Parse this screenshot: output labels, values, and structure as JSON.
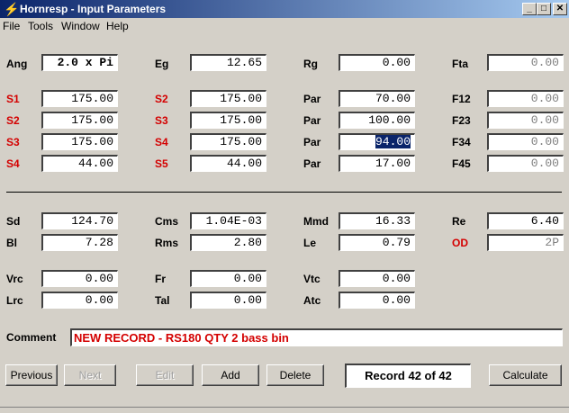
{
  "window": {
    "title": "Hornresp - Input Parameters",
    "minimize": "_",
    "maximize": "□",
    "close": "✕"
  },
  "menu": [
    "File",
    "Tools",
    "Window",
    "Help"
  ],
  "colors": {
    "titlebar": "#0a246a",
    "red_label": "#d40000"
  },
  "row1": {
    "ang": {
      "label": "Ang",
      "value": "2.0 x Pi"
    },
    "eg": {
      "label": "Eg",
      "value": "12.65"
    },
    "rg": {
      "label": "Rg",
      "value": "0.00"
    },
    "fta": {
      "label": "Fta",
      "value": "0.00"
    }
  },
  "segments": [
    {
      "s_a": "S1",
      "v_a": "175.00",
      "s_b": "S2",
      "v_b": "175.00",
      "par": "Par",
      "v_par": "70.00",
      "f": "F12",
      "v_f": "0.00"
    },
    {
      "s_a": "S2",
      "v_a": "175.00",
      "s_b": "S3",
      "v_b": "175.00",
      "par": "Par",
      "v_par": "100.00",
      "f": "F23",
      "v_f": "0.00"
    },
    {
      "s_a": "S3",
      "v_a": "175.00",
      "s_b": "S4",
      "v_b": "175.00",
      "par": "Par",
      "v_par": "94.00",
      "f": "F34",
      "v_f": "0.00"
    },
    {
      "s_a": "S4",
      "v_a": "44.00",
      "s_b": "S5",
      "v_b": "44.00",
      "par": "Par",
      "v_par": "17.00",
      "f": "F45",
      "v_f": "0.00"
    }
  ],
  "driver": {
    "sd": {
      "label": "Sd",
      "value": "124.70"
    },
    "cms": {
      "label": "Cms",
      "value": "1.04E-03"
    },
    "mmd": {
      "label": "Mmd",
      "value": "16.33"
    },
    "re": {
      "label": "Re",
      "value": "6.40"
    },
    "bl": {
      "label": "Bl",
      "value": "7.28"
    },
    "rms": {
      "label": "Rms",
      "value": "2.80"
    },
    "le": {
      "label": "Le",
      "value": "0.79"
    },
    "od": {
      "label": "OD",
      "value": "2P"
    }
  },
  "chamber": {
    "vrc": {
      "label": "Vrc",
      "value": "0.00"
    },
    "fr": {
      "label": "Fr",
      "value": "0.00"
    },
    "vtc": {
      "label": "Vtc",
      "value": "0.00"
    },
    "lrc": {
      "label": "Lrc",
      "value": "0.00"
    },
    "tal": {
      "label": "Tal",
      "value": "0.00"
    },
    "atc": {
      "label": "Atc",
      "value": "0.00"
    }
  },
  "comment": {
    "label": "Comment",
    "value": "NEW RECORD - RS180 QTY 2 bass bin"
  },
  "buttons": {
    "previous": "Previous",
    "next": "Next",
    "edit": "Edit",
    "add": "Add",
    "delete": "Delete",
    "calculate": "Calculate"
  },
  "record": "Record 42 of 42"
}
